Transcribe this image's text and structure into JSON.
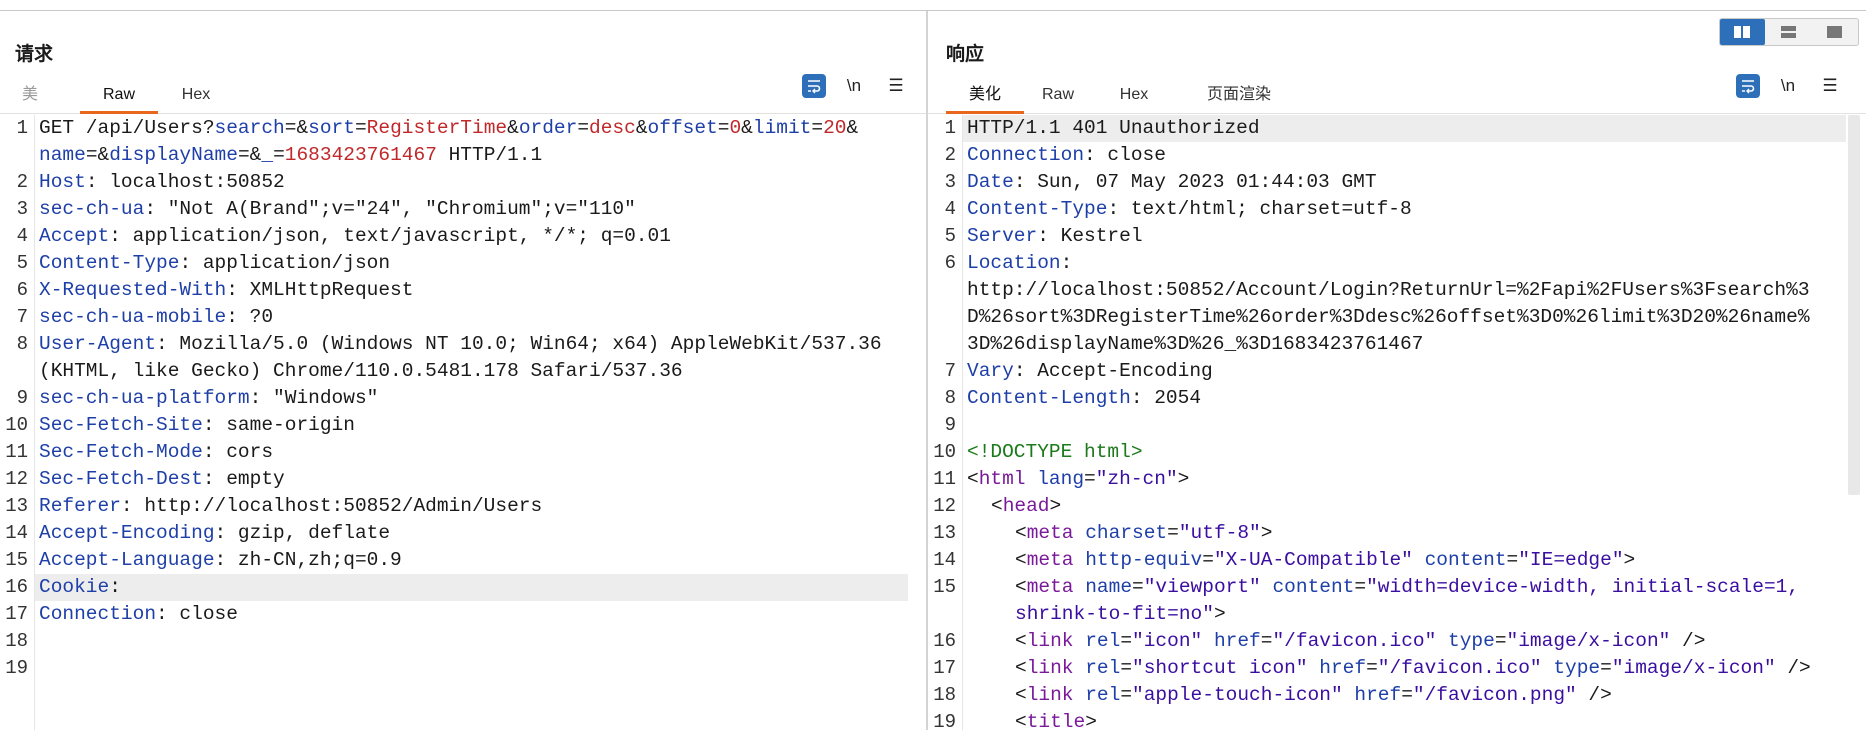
{
  "request": {
    "title": "请求",
    "tabs": [
      {
        "label": "美",
        "state": "dim"
      },
      {
        "label": "Raw",
        "state": "active"
      },
      {
        "label": "Hex",
        "state": "normal"
      }
    ],
    "tools": {
      "wrap_icon": "wrap-lines-icon",
      "newline_label": "\\n",
      "menu_label": "☰"
    },
    "line_numbers": [
      "1",
      "2",
      "3",
      "4",
      "5",
      "6",
      "7",
      "8",
      "9",
      "10",
      "11",
      "12",
      "13",
      "14",
      "15",
      "16",
      "17",
      "18",
      "19"
    ],
    "lines": {
      "l1a": {
        "method": "GET /api/Users?",
        "p1k": "search",
        "eq1": "=&",
        "p2k": "sort",
        "eq2": "=",
        "p2v": "RegisterTime",
        "amp2": "&",
        "p3k": "order",
        "eq3": "=",
        "p3v": "desc",
        "amp3": "&",
        "p4k": "offset",
        "eq4": "=",
        "p4v": "0",
        "amp4": "&",
        "p5k": "limit",
        "eq5": "=",
        "p5v": "20",
        "amp5": "&"
      },
      "l1b": {
        "p6k": "name",
        "eq6": "=&",
        "p7k": "displayName",
        "eq7": "=&",
        "p8k": "_",
        "eq8": "=",
        "p8v": "1683423761467",
        "proto": " HTTP/1.1"
      },
      "l2": {
        "k": "Host",
        "v": ": localhost:50852"
      },
      "l3": {
        "k": "sec-ch-ua",
        "v": ": \"Not A(Brand\";v=\"24\", \"Chromium\";v=\"110\""
      },
      "l4": {
        "k": "Accept",
        "v": ": application/json, text/javascript, */*; q=0.01"
      },
      "l5": {
        "k": "Content-Type",
        "v": ": application/json"
      },
      "l6": {
        "k": "X-Requested-With",
        "v": ": XMLHttpRequest"
      },
      "l7": {
        "k": "sec-ch-ua-mobile",
        "v": ": ?0"
      },
      "l8a": {
        "k": "User-Agent",
        "v": ": Mozilla/5.0 (Windows NT 10.0; Win64; x64) AppleWebKit/537.36"
      },
      "l8b": {
        "v": "(KHTML, like Gecko) Chrome/110.0.5481.178 Safari/537.36"
      },
      "l9": {
        "k": "sec-ch-ua-platform",
        "v": ": \"Windows\""
      },
      "l10": {
        "k": "Sec-Fetch-Site",
        "v": ": same-origin"
      },
      "l11": {
        "k": "Sec-Fetch-Mode",
        "v": ": cors"
      },
      "l12": {
        "k": "Sec-Fetch-Dest",
        "v": ": empty"
      },
      "l13": {
        "k": "Referer",
        "v": ": http://localhost:50852/Admin/Users"
      },
      "l14": {
        "k": "Accept-Encoding",
        "v": ": gzip, deflate"
      },
      "l15": {
        "k": "Accept-Language",
        "v": ": zh-CN,zh;q=0.9"
      },
      "l16": {
        "k": "Cookie",
        "v": ":"
      },
      "l17": {
        "k": "Connection",
        "v": ": close"
      }
    }
  },
  "response": {
    "title": "响应",
    "tabs": [
      {
        "label": "美化",
        "state": "active"
      },
      {
        "label": "Raw",
        "state": "normal"
      },
      {
        "label": "Hex",
        "state": "normal"
      },
      {
        "label": "页面渲染",
        "state": "normal"
      }
    ],
    "tools": {
      "wrap_icon": "wrap-lines-icon",
      "newline_label": "\\n",
      "menu_label": "☰"
    },
    "line_numbers": [
      "1",
      "2",
      "3",
      "4",
      "5",
      "6",
      "7",
      "8",
      "9",
      "10",
      "11",
      "12",
      "13",
      "14",
      "15",
      "16",
      "17",
      "18",
      "19"
    ],
    "lines": {
      "l1": "HTTP/1.1 401 Unauthorized",
      "l2": {
        "k": "Connection",
        "v": ": close"
      },
      "l3": {
        "k": "Date",
        "v": ": Sun, 07 May 2023 01:44:03 GMT"
      },
      "l4": {
        "k": "Content-Type",
        "v": ": text/html; charset=utf-8"
      },
      "l5": {
        "k": "Server",
        "v": ": Kestrel"
      },
      "l6": {
        "k": "Location",
        "v": ":"
      },
      "l6b": "http://localhost:50852/Account/Login?ReturnUrl=%2Fapi%2FUsers%3Fsearch%3",
      "l6c": "D%26sort%3DRegisterTime%26order%3Ddesc%26offset%3D0%26limit%3D20%26name%",
      "l6d": "3D%26displayName%3D%26_%3D1683423761467",
      "l7": {
        "k": "Vary",
        "v": ": Accept-Encoding"
      },
      "l8": {
        "k": "Content-Length",
        "v": ": 2054"
      },
      "l10": "<!DOCTYPE html>",
      "l11": {
        "open": "<",
        "tag": "html",
        "sp": " ",
        "a1": "lang",
        "eq": "=",
        "s1": "\"zh-cn\"",
        "close": ">"
      },
      "l12": {
        "open": "<",
        "tag": "head",
        "close": ">"
      },
      "l13": {
        "open": "<",
        "tag": "meta",
        "sp": " ",
        "a1": "charset",
        "eq": "=",
        "s1": "\"utf-8\"",
        "close": ">"
      },
      "l14": {
        "open": "<",
        "tag": "meta",
        "sp": " ",
        "a1": "http-equiv",
        "eq": "=",
        "s1": "\"X-UA-Compatible\"",
        "sp2": " ",
        "a2": "content",
        "eq2": "=",
        "s2": "\"IE=edge\"",
        "close": ">"
      },
      "l15": {
        "open": "<",
        "tag": "meta",
        "sp": " ",
        "a1": "name",
        "eq": "=",
        "s1": "\"viewport\"",
        "sp2": " ",
        "a2": "content",
        "eq2": "=",
        "s2": "\"width=device-width, initial-scale=1,"
      },
      "l15b": {
        "s": "shrink-to-fit=no\"",
        "close": ">"
      },
      "l16": {
        "open": "<",
        "tag": "link",
        "sp": " ",
        "a1": "rel",
        "eq": "=",
        "s1": "\"icon\"",
        "sp2": " ",
        "a2": "href",
        "eq2": "=",
        "s2": "\"/favicon.ico\"",
        "sp3": " ",
        "a3": "type",
        "eq3": "=",
        "s3": "\"image/x-icon\"",
        "close": " />"
      },
      "l17": {
        "open": "<",
        "tag": "link",
        "sp": " ",
        "a1": "rel",
        "eq": "=",
        "s1": "\"shortcut icon\"",
        "sp2": " ",
        "a2": "href",
        "eq2": "=",
        "s2": "\"/favicon.ico\"",
        "sp3": " ",
        "a3": "type",
        "eq3": "=",
        "s3": "\"image/x-icon\"",
        "close": " />"
      },
      "l18": {
        "open": "<",
        "tag": "link",
        "sp": " ",
        "a1": "rel",
        "eq": "=",
        "s1": "\"apple-touch-icon\"",
        "sp2": " ",
        "a2": "href",
        "eq2": "=",
        "s2": "\"/favicon.png\"",
        "close": " />"
      },
      "l19": {
        "open": "<",
        "tag": "title",
        "close": ">"
      }
    }
  },
  "layout_buttons": [
    {
      "name": "split-horizontal-icon",
      "state": "active"
    },
    {
      "name": "split-vertical-icon",
      "state": "normal"
    },
    {
      "name": "single-pane-icon",
      "state": "normal"
    }
  ]
}
